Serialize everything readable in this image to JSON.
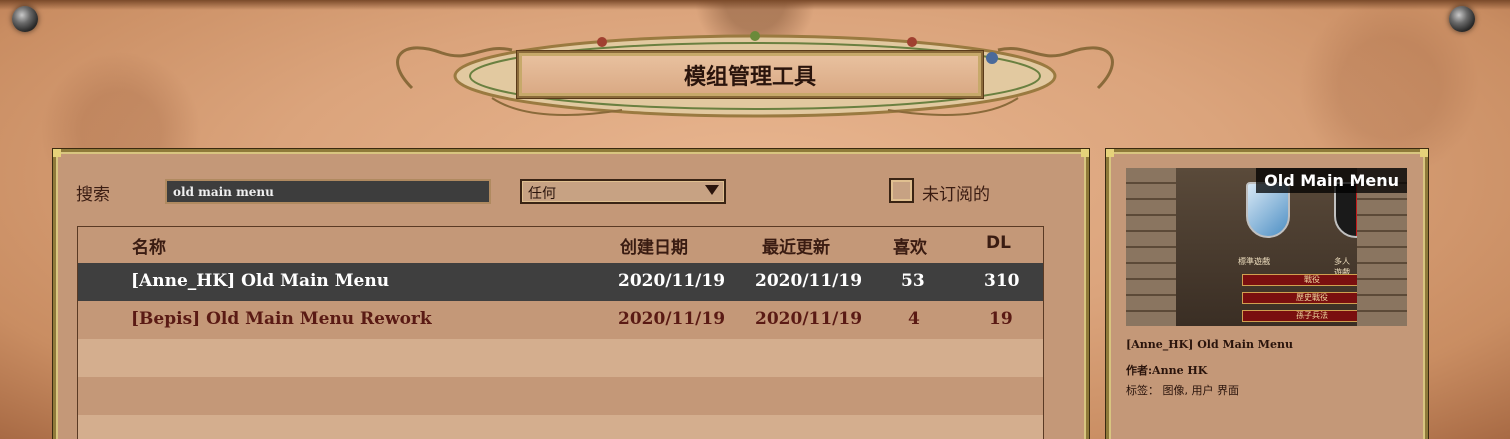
{
  "title": "模组管理工具",
  "search": {
    "label": "搜索",
    "value": "old main menu"
  },
  "filter": {
    "selected": "任何"
  },
  "unsubscribed": {
    "label": "未订阅的",
    "checked": false
  },
  "table": {
    "headers": {
      "name": "名称",
      "created": "创建日期",
      "updated": "最近更新",
      "likes": "喜欢",
      "downloads": "DL"
    },
    "rows": [
      {
        "name": "[Anne_HK] Old Main Menu",
        "created": "2020/11/19",
        "updated": "2020/11/19",
        "likes": "53",
        "downloads": "310",
        "selected": true
      },
      {
        "name": "[Bepis] Old Main Menu Rework",
        "created": "2020/11/19",
        "updated": "2020/11/19",
        "likes": "4",
        "downloads": "19",
        "selected": false
      }
    ]
  },
  "details": {
    "preview_title": "Old Main Menu",
    "preview_standard": "標準遊戲",
    "preview_multi": "多人遊戲",
    "preview_menu": [
      "戰役",
      "歷史戰役",
      "孫子兵法"
    ],
    "name": "[Anne_HK] Old Main Menu",
    "author": "作者:Anne HK",
    "tags": "标签： 图像, 用户 界面"
  },
  "colors": {
    "parchment": "#dba47c",
    "panel": "#c49878",
    "selected_row": "#3f3f3f",
    "gold_border": "#8f7a3a"
  }
}
